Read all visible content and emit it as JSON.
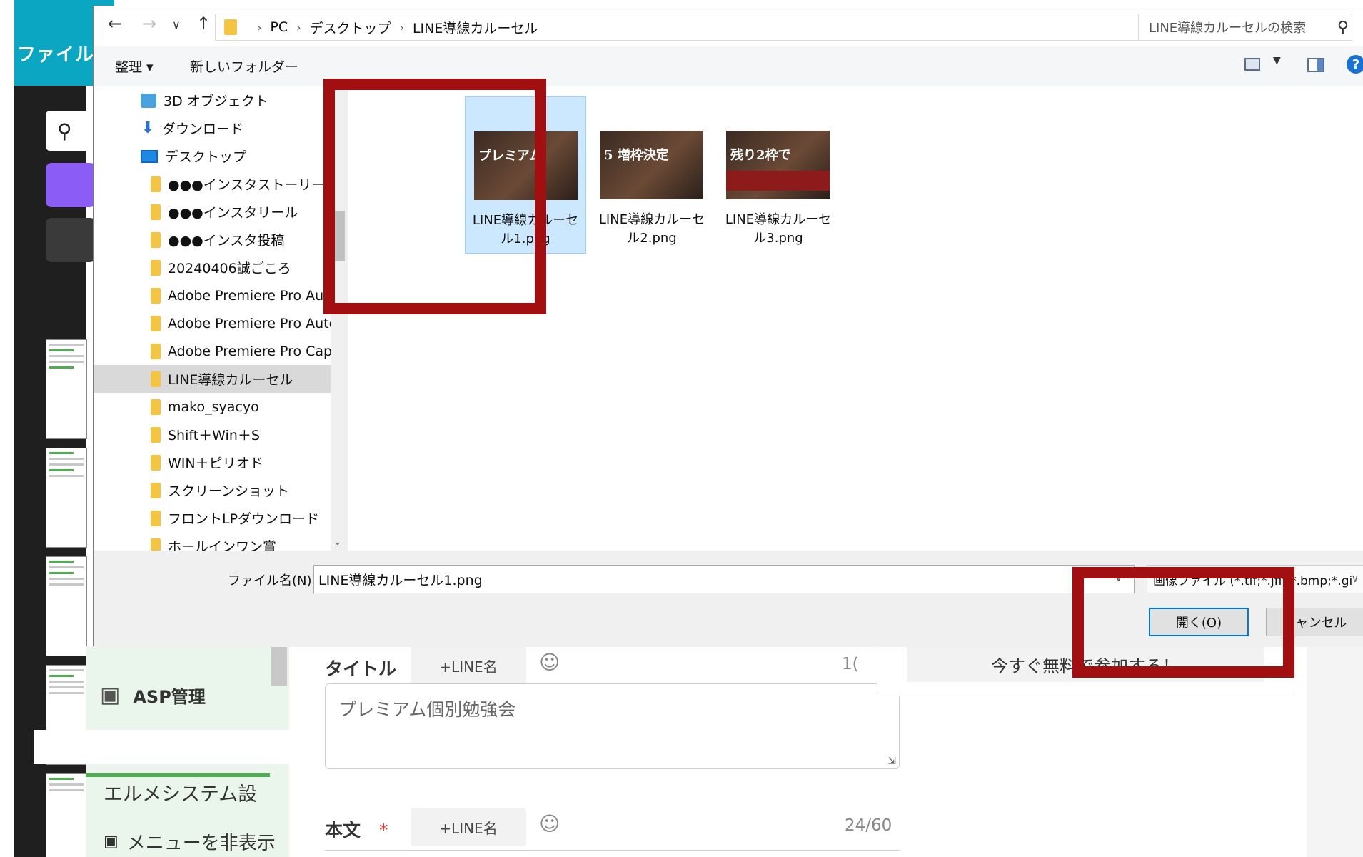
{
  "background_app": {
    "brand_label": "ファイル",
    "sidebar": {
      "asp_label": "ASP管理",
      "system_settings_label": "エルメシステム設",
      "hide_menu_label": "メニューを非表示"
    },
    "form": {
      "title_label": "タイトル",
      "title_line_name_label": "+LINE名",
      "title_counter": "1(",
      "title_value": "プレミアム個別勉強会",
      "body_label": "本文",
      "body_required_mark": "*",
      "body_line_name_label": "+LINE名",
      "body_counter": "24/60"
    },
    "cta_button_label": "今すぐ無料で参加する！"
  },
  "dialog": {
    "breadcrumb": [
      "PC",
      "デスクトップ",
      "LINE導線カルーセル"
    ],
    "search_placeholder": "LINE導線カルーセルの検索",
    "commands": {
      "organize_label": "整理 ▾",
      "new_folder_label": "新しいフォルダー"
    },
    "nav_items": [
      {
        "label": "3D オブジェクト",
        "icon": "3d-objects-icon",
        "indent": 1
      },
      {
        "label": "ダウンロード",
        "icon": "download-icon",
        "indent": 1
      },
      {
        "label": "デスクトップ",
        "icon": "desktop-icon",
        "indent": 1
      },
      {
        "label": "●●●インスタストーリーズ",
        "icon": "folder-icon",
        "indent": 2
      },
      {
        "label": "●●●インスタリール",
        "icon": "folder-icon",
        "indent": 2
      },
      {
        "label": "●●●インスタ投稿",
        "icon": "folder-icon",
        "indent": 2
      },
      {
        "label": "20240406誠ごころ",
        "icon": "folder-icon",
        "indent": 2
      },
      {
        "label": "Adobe Premiere Pro Aud",
        "icon": "folder-icon",
        "indent": 2
      },
      {
        "label": "Adobe Premiere Pro Auto",
        "icon": "folder-icon",
        "indent": 2
      },
      {
        "label": "Adobe Premiere Pro Capt",
        "icon": "folder-icon",
        "indent": 2
      },
      {
        "label": "LINE導線カルーセル",
        "icon": "folder-icon",
        "indent": 2,
        "selected": true
      },
      {
        "label": "mako_syacyo",
        "icon": "folder-icon",
        "indent": 2
      },
      {
        "label": "Shift＋Win＋S",
        "icon": "folder-icon",
        "indent": 2
      },
      {
        "label": "WIN＋ピリオド",
        "icon": "folder-icon",
        "indent": 2
      },
      {
        "label": "スクリーンショット",
        "icon": "folder-icon",
        "indent": 2
      },
      {
        "label": "フロントLPダウンロード",
        "icon": "folder-icon",
        "indent": 2
      },
      {
        "label": "ホールインワン賞",
        "icon": "folder-icon",
        "indent": 2
      }
    ],
    "files": [
      {
        "name_line1": "LINE導線カルーセ",
        "name_line2": "ル1.png",
        "thumb_text": "プレミアム",
        "selected": true
      },
      {
        "name_line1": "LINE導線カルーセ",
        "name_line2": "ル2.png",
        "thumb_text": "5 増枠決定",
        "selected": false
      },
      {
        "name_line1": "LINE導線カルーセ",
        "name_line2": "ル3.png",
        "thumb_text": "残り2枠で",
        "selected": false
      }
    ],
    "filename_label": "ファイル名(N):",
    "filename_value": "LINE導線カルーセル1.png",
    "filetype_value": "画像ファイル (*.tif;*.jfif;*.bmp;*.gi",
    "open_label": "開く(O)",
    "cancel_label": "キャンセル"
  },
  "colors": {
    "highlight_red": "#a20f10",
    "selection_blue": "#cce8ff",
    "app_accent_teal": "#0aa6c2",
    "app_accent_green": "#4caf50"
  }
}
